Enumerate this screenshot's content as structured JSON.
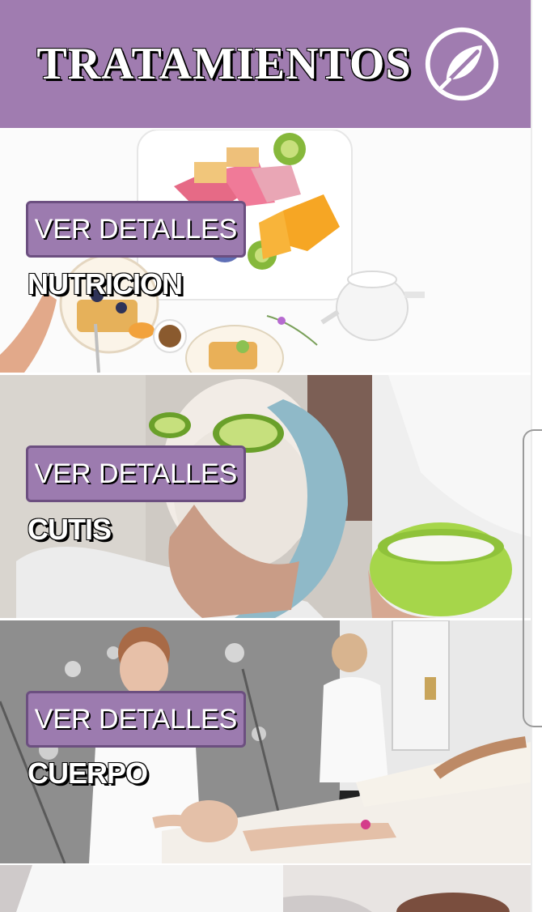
{
  "header": {
    "title": "TRATAMIENTOS",
    "icon": "leaf-icon"
  },
  "colors": {
    "brand": "#a07cb0",
    "button": "#9c7baf",
    "button_border": "#6c4f80"
  },
  "treatments": [
    {
      "label": "NUTRICION",
      "button_label": "VER DETALLES",
      "image": "healthy-breakfast-photo"
    },
    {
      "label": "CUTIS",
      "button_label": "VER DETALLES",
      "image": "facial-mask-photo"
    },
    {
      "label": "CUERPO",
      "button_label": "VER DETALLES",
      "image": "body-massage-photo"
    },
    {
      "label": "",
      "button_label": "",
      "image": "treatment-photo"
    }
  ]
}
